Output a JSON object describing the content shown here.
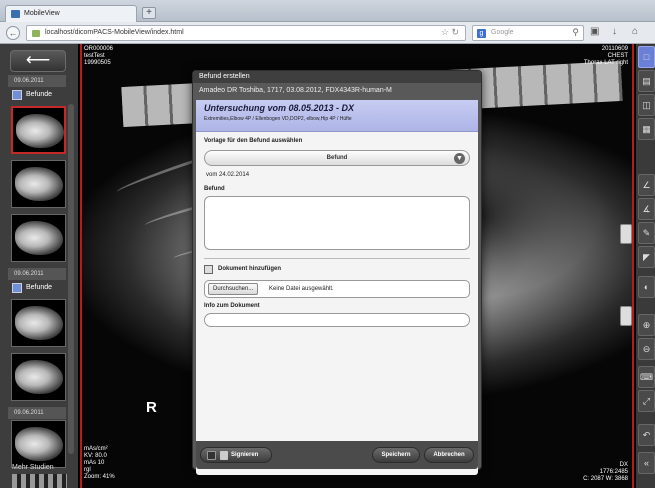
{
  "browser": {
    "tab_title": "MobileView",
    "url": "localhost/dicomPACS-MobileView/index.html",
    "search_placeholder": "Google"
  },
  "sidebar": {
    "groups": [
      {
        "date": "09.06.2011",
        "befunde_label": "Befunde"
      },
      {
        "date": "09.06.2011",
        "befunde_label": "Befunde"
      },
      {
        "date": "09.06.2011"
      }
    ],
    "more_label": "Mehr Studien"
  },
  "viewer": {
    "top_left": [
      "OR000006",
      "testTest",
      "19990505"
    ],
    "top_right": [
      "20110609",
      "CHEST",
      "Thorax LAT right"
    ],
    "bottom_left": [
      "mAs/cm²",
      "KV: 80.0",
      "mAs 10",
      "rgl",
      "Zoom: 41%"
    ],
    "bottom_right": [
      "DX",
      "1776:2485",
      "C: 2087 W: 3868"
    ],
    "marker": "R"
  },
  "dialog": {
    "title": "Befund erstellen",
    "device": "Amadeo DR Toshiba, 1717, 03.08.2012, FDX4343R-human-M",
    "exam_title": "Untersuchung vom 08.05.2013 - DX",
    "exam_sub": "Extremities,Elbow 4P / Ellenbogen VD,DOP2, elbow,Hip 4P / Hüfte",
    "template_label": "Vorlage für den Befund auswählen",
    "template_value": "Befund",
    "template_date": "vom 24.02.2014",
    "befund_label": "Befund",
    "add_doc_label": "Dokument hinzufügen",
    "browse_label": "Durchsuchen...",
    "no_file_label": "Keine Datei ausgewählt.",
    "info_label": "Info zum Dokument",
    "sign_label": "Signieren",
    "save_label": "Speichern",
    "cancel_label": "Abbrechen"
  }
}
